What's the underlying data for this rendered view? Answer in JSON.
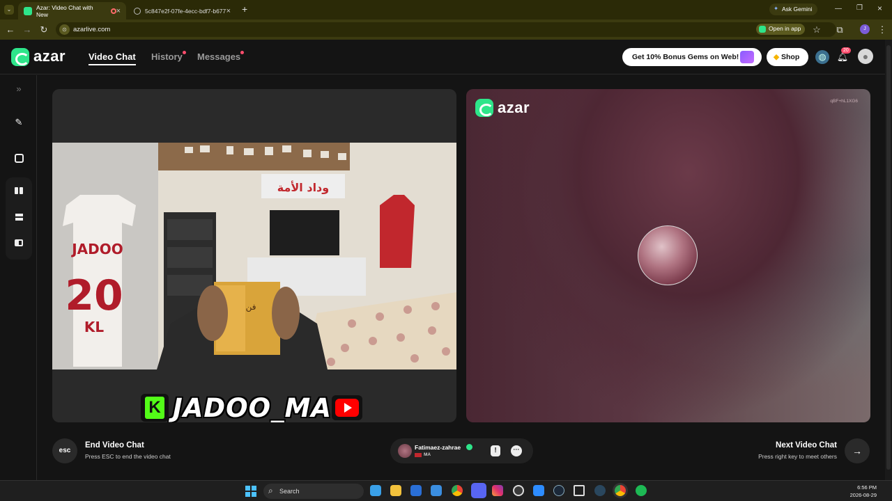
{
  "browser": {
    "tabs": [
      {
        "title": "Azar: Video Chat with New",
        "active": true,
        "favicon_color": "#2ee58a"
      },
      {
        "title": "5c847e2f-07fe-4ecc-bdf7-b677",
        "active": false,
        "favicon_color": "#888888"
      }
    ],
    "new_tab": "+",
    "ask_gemini": "Ask Gemini",
    "url": "azarlive.com",
    "open_in_app": "Open in app"
  },
  "header": {
    "logo": "azar",
    "nav": [
      {
        "label": "Video Chat",
        "active": true,
        "dot": false
      },
      {
        "label": "History",
        "active": false,
        "dot": true
      },
      {
        "label": "Messages",
        "active": false,
        "dot": true
      }
    ],
    "bonus_label": "Get 10% Bonus Gems on Web!",
    "shop_label": "Shop",
    "notification_count": "20"
  },
  "left_video": {
    "overlay_name": "JADOO_MA"
  },
  "right_video": {
    "logo": "azar",
    "code": "qBF+hL1XG6"
  },
  "footer": {
    "esc_label": "esc",
    "end_title": "End Video Chat",
    "end_sub": "Press ESC to end the video chat",
    "partner_name": "Fatimaez-zahrae",
    "partner_country": "MA",
    "report_label": "!",
    "chat_label": "···",
    "next_title": "Next Video Chat",
    "next_sub": "Press right key to meet others",
    "next_arrow": "→"
  },
  "taskbar": {
    "search_label": "Search",
    "time": "6:56 PM",
    "date": "2026-08-29"
  },
  "colors": {
    "brand": "#2ee58a",
    "notification": "#ff4d6d",
    "taskbar_accent": "#4cc2ff"
  }
}
